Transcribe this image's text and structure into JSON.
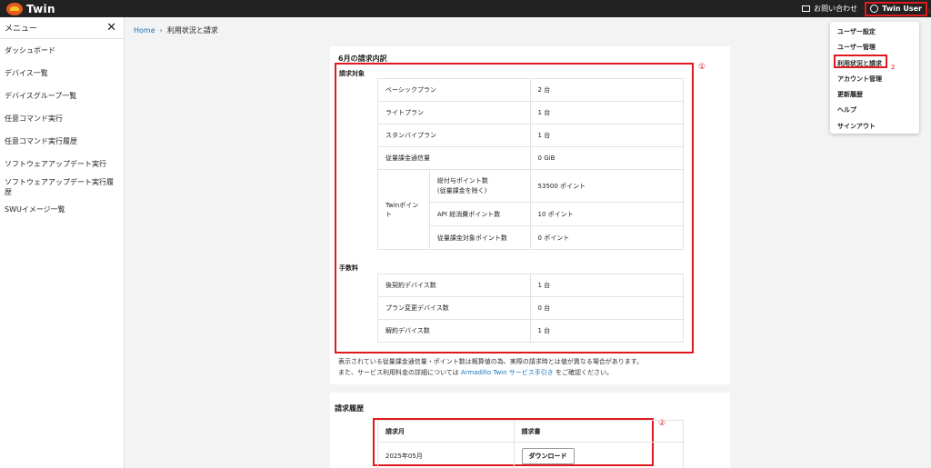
{
  "header": {
    "logo_text": "Twin",
    "contact_label": "お問い合わせ",
    "user_label": "Twin User"
  },
  "sidebar": {
    "title": "メニュー",
    "items": [
      {
        "label": "ダッシュボード"
      },
      {
        "label": "デバイス一覧"
      },
      {
        "label": "デバイスグループ一覧"
      },
      {
        "label": "任意コマンド実行"
      },
      {
        "label": "任意コマンド実行履歴"
      },
      {
        "label": "ソフトウェアアップデート実行"
      },
      {
        "label": "ソフトウェアアップデート実行履歴"
      },
      {
        "label": "SWUイメージ一覧"
      }
    ]
  },
  "breadcrumb": {
    "home": "Home",
    "separator": "›",
    "current": "利用状況と請求"
  },
  "billing": {
    "title": "6月の請求内訳",
    "annotation": "①",
    "billing_target_label": "請求対象",
    "plans": [
      {
        "name": "ベーシックプラン",
        "value": "2 台"
      },
      {
        "name": "ライトプラン",
        "value": "1 台"
      },
      {
        "name": "スタンバイプラン",
        "value": "1 台"
      },
      {
        "name": "従量課金通信量",
        "value": "0 GiB"
      }
    ],
    "twin_points": {
      "label": "Twinポイント",
      "rows": [
        {
          "name": "総付与ポイント数\n(従量課金を除く)",
          "value": "53500 ポイント"
        },
        {
          "name": "API 総消費ポイント数",
          "value": "10 ポイント"
        },
        {
          "name": "従量課金対象ポイント数",
          "value": "0 ポイント"
        }
      ]
    },
    "fees_label": "手数料",
    "fees": [
      {
        "name": "後契約デバイス数",
        "value": "1 台"
      },
      {
        "name": "プラン変更デバイス数",
        "value": "0 台"
      },
      {
        "name": "解約デバイス数",
        "value": "1 台"
      }
    ],
    "note_line1": "表示されている従量課金通信量・ポイント数は概算値の為、実際の請求時とは値が異なる場合があります。",
    "note_line2_before": "また、サービス利用料金の詳細については",
    "note_line2_link": "Armadillo Twin サービス手引き",
    "note_line2_after": "をご確認ください。"
  },
  "history": {
    "title": "請求履歴",
    "annotation": "②",
    "col_month": "請求月",
    "col_invoice": "請求書",
    "rows": [
      {
        "month": "2025年05月",
        "button": "ダウンロード"
      }
    ]
  },
  "dropdown": {
    "items": [
      {
        "label": "ユーザー設定"
      },
      {
        "label": "ユーザー管理"
      },
      {
        "label": "利用状況と請求"
      },
      {
        "label": "アカウント管理"
      },
      {
        "label": "更新履歴"
      },
      {
        "label": "ヘルプ"
      },
      {
        "label": "サインアウト"
      }
    ],
    "annotation_2": "2",
    "annotation_1": "1"
  }
}
